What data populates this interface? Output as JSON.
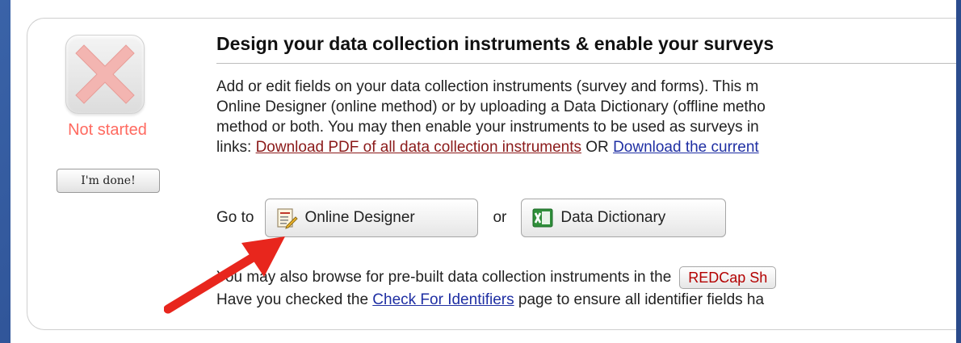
{
  "status": {
    "label": "Not started",
    "done_button": "I'm done!",
    "icon": "x-icon",
    "color": "#ff6a60"
  },
  "section": {
    "title": "Design your data collection instruments & enable your surveys",
    "description_lines": [
      "Add or edit fields on your data collection instruments (survey and forms). This m",
      "Online Designer (online method) or by uploading a Data Dictionary (offline metho",
      "method or both. You may then enable your instruments to be used as surveys in"
    ],
    "links_prefix": "links: ",
    "pdf_link": "Download PDF of all data collection instruments",
    "or_text": " OR ",
    "current_link": "Download the current"
  },
  "goto": {
    "label": "Go to",
    "or": "or",
    "online_designer": "Online Designer",
    "data_dictionary": "Data Dictionary"
  },
  "browse": {
    "line1_text": "You may also browse for pre-built data collection instruments in the",
    "shared_button": "REDCap Sh",
    "line2_prefix": "Have you checked the ",
    "identifiers_link": "Check For Identifiers",
    "line2_suffix": " page to ensure all identifier fields ha"
  },
  "colors": {
    "background": "#2c4f92",
    "link_red": "#8b1a1a",
    "link_blue": "#1f2fa3",
    "arrow": "#e8261d"
  }
}
